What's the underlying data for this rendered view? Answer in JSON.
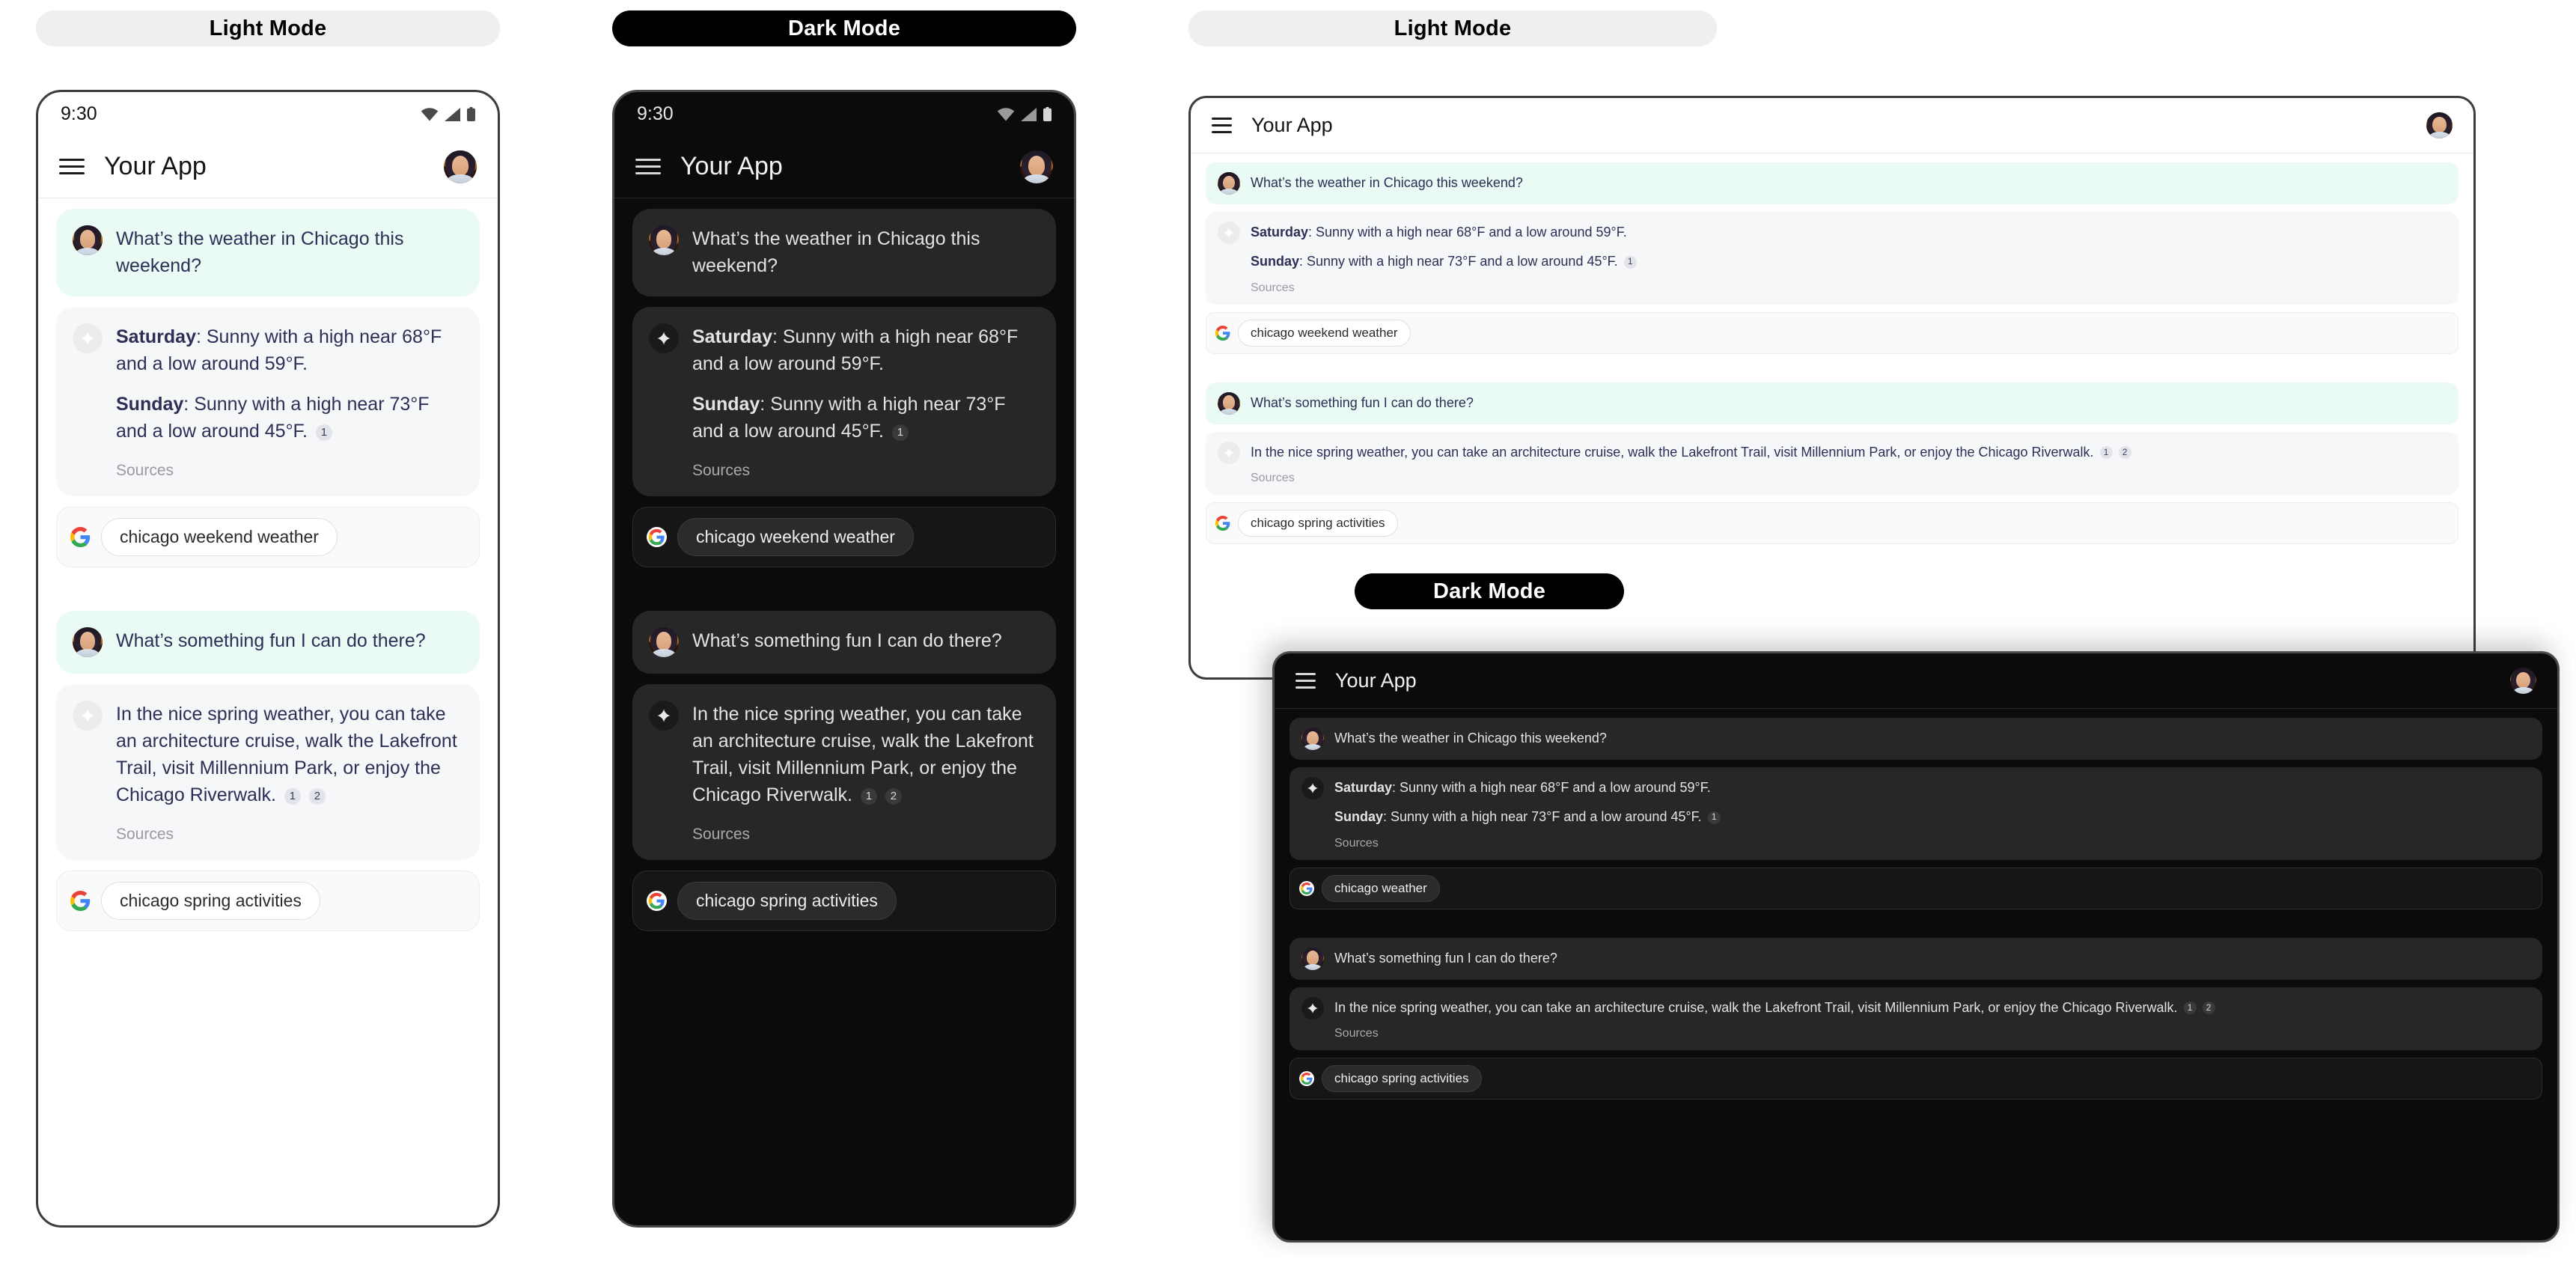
{
  "labels": {
    "light_mode": "Light Mode",
    "dark_mode": "Dark Mode"
  },
  "colors": {
    "user_bubble_light": "#eafaf4",
    "assistant_bubble_light": "#f6f7f9",
    "bubble_dark": "#272727",
    "text_light": "#2c2f56",
    "text_dark": "#e3e3e3",
    "sources_light": "#9a9aa3",
    "pill_light_bg": "#efefef",
    "pill_dark_bg": "#000000",
    "google_blue": "#4285F4",
    "google_red": "#EA4335",
    "google_yellow": "#FBBC05",
    "google_green": "#34A853"
  },
  "statusbar": {
    "time": "9:30",
    "icons": [
      "wifi-icon",
      "cellular-signal-icon",
      "battery-icon"
    ]
  },
  "appbar": {
    "menu_icon": "hamburger-menu-icon",
    "title": "Your App",
    "avatar": "user-avatar"
  },
  "conversation": {
    "turn1": {
      "user": "What’s the weather in Chicago this weekend?",
      "assistant": {
        "line1_label": "Saturday",
        "line1_text": ": Sunny with a high near 68°F and a low around 59°F.",
        "line2_label": "Sunday",
        "line2_text": ": Sunny with a high near 73°F and a low around 45°F.",
        "citations": [
          "1"
        ],
        "sources_label": "Sources"
      },
      "search_chip_long": "chicago weekend weather",
      "search_chip_short": "chicago weather"
    },
    "turn2": {
      "user": "What’s something fun I can do there?",
      "assistant": {
        "text": "In the nice spring weather, you can take an architecture cruise, walk the Lakefront Trail, visit Millennium Park, or enjoy the Chicago Riverwalk.",
        "citations": [
          "1",
          "2"
        ],
        "sources_label": "Sources"
      },
      "search_chip": "chicago spring activities"
    }
  },
  "panels": [
    {
      "id": "phone-light",
      "mode": "Light Mode",
      "device": "phone",
      "has_statusbar": true
    },
    {
      "id": "phone-dark",
      "mode": "Dark Mode",
      "device": "phone",
      "has_statusbar": true
    },
    {
      "id": "tablet-light",
      "mode": "Light Mode",
      "device": "tablet",
      "has_statusbar": false
    },
    {
      "id": "tablet-dark",
      "mode": "Dark Mode",
      "device": "tablet",
      "has_statusbar": false
    }
  ]
}
